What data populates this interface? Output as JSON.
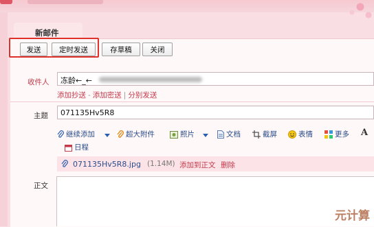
{
  "compose": {
    "tab_title": "新邮件",
    "toolbar": {
      "send_label": "发送",
      "schedule_send_label": "定时发送",
      "save_draft_label": "存草稿",
      "close_label": "关闭"
    },
    "recipient": {
      "label": "收件人",
      "value": "冻龄←_←"
    },
    "recipient_links": {
      "add_cc": "添加抄送",
      "dash": "-",
      "add_bcc": "添加密送",
      "pipe": "|",
      "separate_send": "分别发送"
    },
    "subject": {
      "label": "主题",
      "value": "071135Hv5R8"
    },
    "attach_toolbar": {
      "continue_add": "继续添加",
      "large_attachment": "超大附件",
      "photo": "照片",
      "document": "文档",
      "screenshot": "截屏",
      "emoji": "表情",
      "more": "更多",
      "schedule": "日程"
    },
    "attachment": {
      "filename": "071135Hv5R8.jpg",
      "size": "(1.14M)",
      "add_to_body": "添加到正文",
      "delete": "删除"
    },
    "body_label": "正文"
  },
  "watermark": "元计算",
  "colors": {
    "accent_red": "#c43a4b",
    "highlight_box": "#e0302a",
    "link_blue": "#2a4d8a"
  }
}
